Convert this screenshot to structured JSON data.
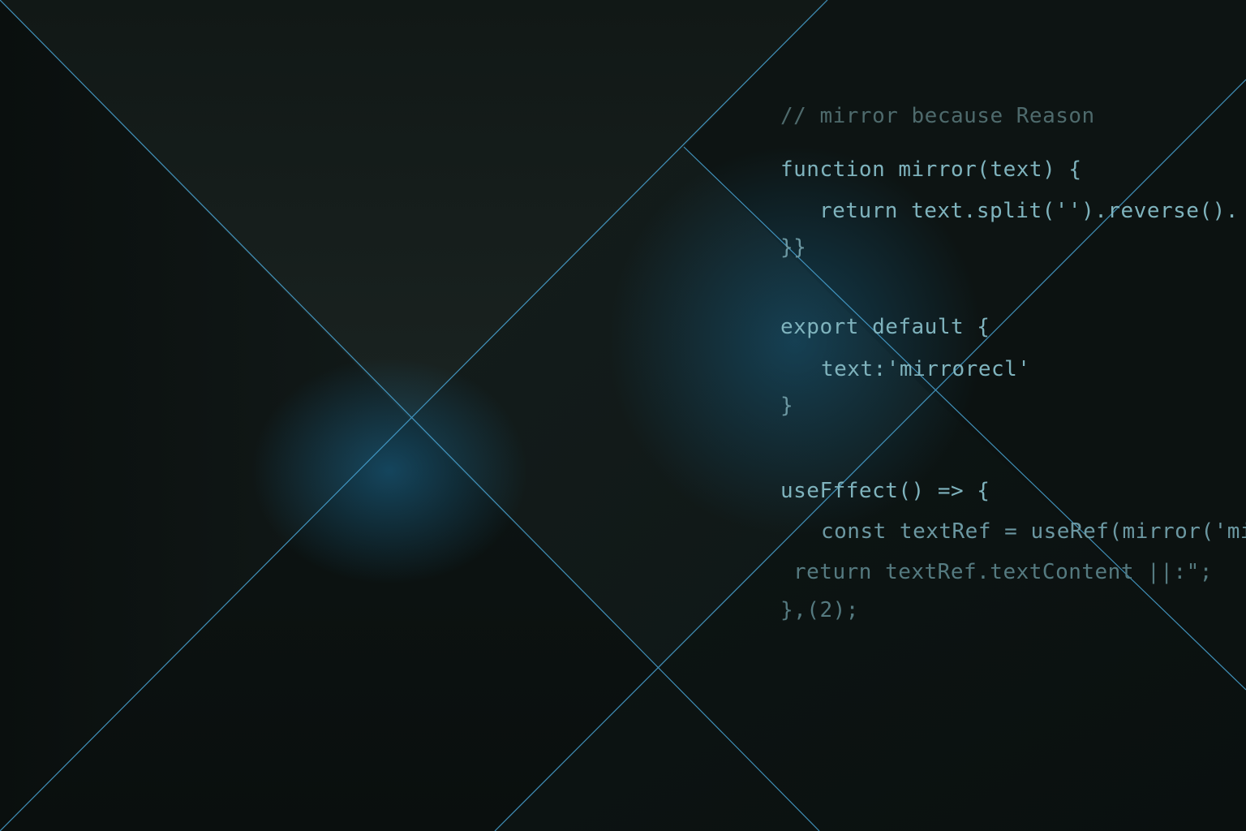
{
  "code": {
    "comment": "// mirror because Reason",
    "lines": [
      "function mirror(text) {",
      "return text.split('').reverse().",
      "}}",
      "export default {",
      "text:'mirrorecl'",
      "}",
      "useFffect() => {",
      "const textRef = useRef(mirror('mirr",
      "return textRef.textContent ||:\";",
      "},(2);"
    ]
  },
  "colors": {
    "background": "#0c1211",
    "accent_line": "#4aa6d6",
    "glow": "#1b6e9a",
    "code_text": "#7fb3bd",
    "comment_text": "#4e6a6c"
  }
}
